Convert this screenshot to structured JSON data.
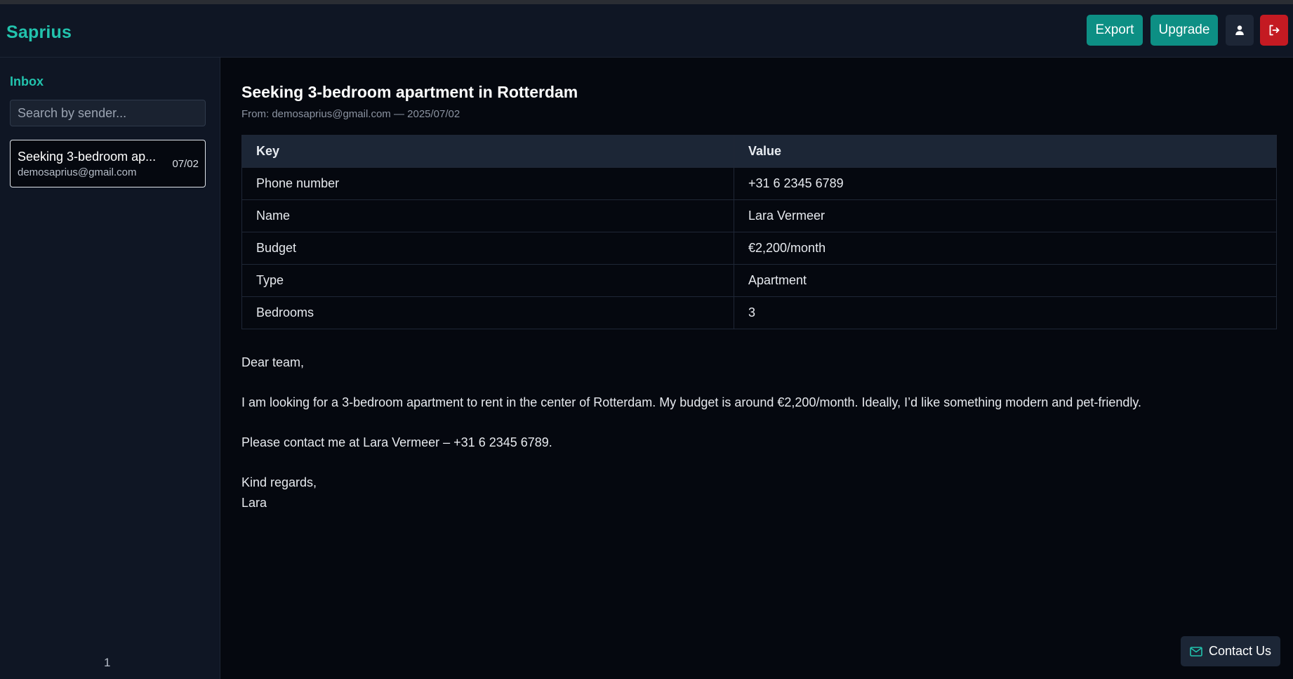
{
  "app": {
    "name": "Saprius"
  },
  "header": {
    "export_label": "Export",
    "upgrade_label": "Upgrade",
    "profile_icon": "user-icon",
    "logout_icon": "logout-icon",
    "colors": {
      "accent": "#0d8f84",
      "logo": "#22c3ad",
      "danger": "#c41a22"
    }
  },
  "sidebar": {
    "title": "Inbox",
    "search": {
      "placeholder": "Search by sender...",
      "value": ""
    },
    "items": [
      {
        "subject": "Seeking 3-bedroom ap...",
        "sender": "demosaprius@gmail.com",
        "date": "07/02",
        "selected": true
      }
    ],
    "page": "1"
  },
  "email": {
    "subject": "Seeking 3-bedroom apartment in Rotterdam",
    "from_label": "From:",
    "from": "demosaprius@gmail.com",
    "separator": "—",
    "date": "2025/07/02",
    "table": {
      "headers": [
        "Key",
        "Value"
      ],
      "rows": [
        [
          "Phone number",
          "+31 6 2345 6789"
        ],
        [
          "Name",
          "Lara Vermeer"
        ],
        [
          "Budget",
          "€2,200/month"
        ],
        [
          "Type",
          "Apartment"
        ],
        [
          "Bedrooms",
          "3"
        ]
      ]
    },
    "body": {
      "greeting": "Dear team,",
      "paragraph1": "I am looking for a 3-bedroom apartment to rent in the center of Rotterdam. My budget is around €2,200/month. Ideally, I’d like something modern and pet-friendly.",
      "paragraph2": "Please contact me at Lara Vermeer – +31 6 2345 6789.",
      "closing": "Kind regards,",
      "signature": "Lara"
    }
  },
  "contact": {
    "label": "Contact Us",
    "icon": "mail-icon"
  }
}
